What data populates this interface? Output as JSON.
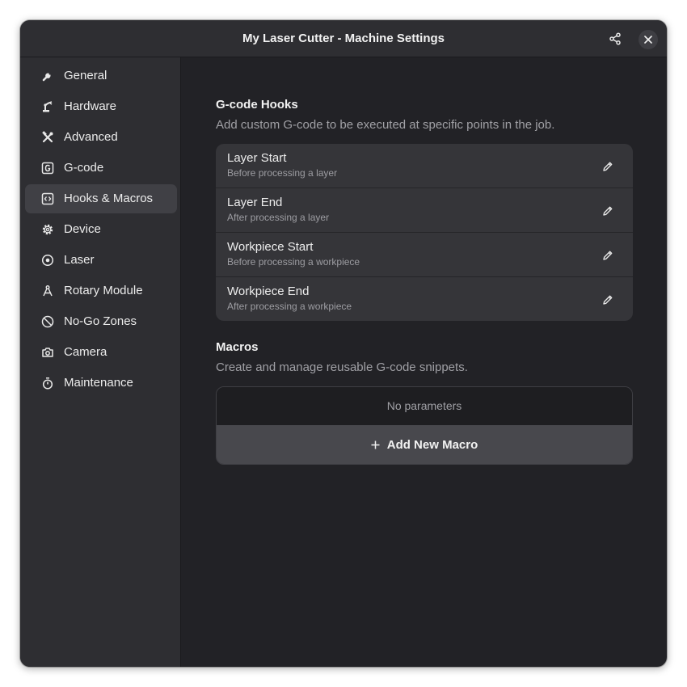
{
  "window": {
    "title": "My Laser Cutter - Machine Settings"
  },
  "header": {
    "share_icon": "share-icon",
    "close_icon": "close-icon"
  },
  "sidebar": {
    "selected": "Hooks & Macros",
    "items": [
      {
        "label": "General",
        "icon": "wrench-icon"
      },
      {
        "label": "Hardware",
        "icon": "robot-arm-icon"
      },
      {
        "label": "Advanced",
        "icon": "tools-icon"
      },
      {
        "label": "G-code",
        "icon": "gcode-icon"
      },
      {
        "label": "Hooks & Macros",
        "icon": "code-brackets-icon"
      },
      {
        "label": "Device",
        "icon": "gear-icon"
      },
      {
        "label": "Laser",
        "icon": "target-icon"
      },
      {
        "label": "Rotary Module",
        "icon": "rotary-icon"
      },
      {
        "label": "No-Go Zones",
        "icon": "no-entry-icon"
      },
      {
        "label": "Camera",
        "icon": "camera-icon"
      },
      {
        "label": "Maintenance",
        "icon": "stopwatch-icon"
      }
    ]
  },
  "gcode_hooks": {
    "title": "G-code Hooks",
    "subtitle": "Add custom G-code to be executed at specific points in the job.",
    "items": [
      {
        "title": "Layer Start",
        "subtitle": "Before processing a layer"
      },
      {
        "title": "Layer End",
        "subtitle": "After processing a layer"
      },
      {
        "title": "Workpiece Start",
        "subtitle": "Before processing a workpiece"
      },
      {
        "title": "Workpiece End",
        "subtitle": "After processing a workpiece"
      }
    ]
  },
  "macros": {
    "title": "Macros",
    "subtitle": "Create and manage reusable G-code snippets.",
    "empty_text": "No parameters",
    "add_label": "Add New Macro"
  },
  "colors": {
    "window_bg": "#222226",
    "sidebar_bg": "#2e2e32",
    "active_item_bg": "#404045",
    "list_bg": "#353539",
    "button_bg": "#48484d"
  }
}
